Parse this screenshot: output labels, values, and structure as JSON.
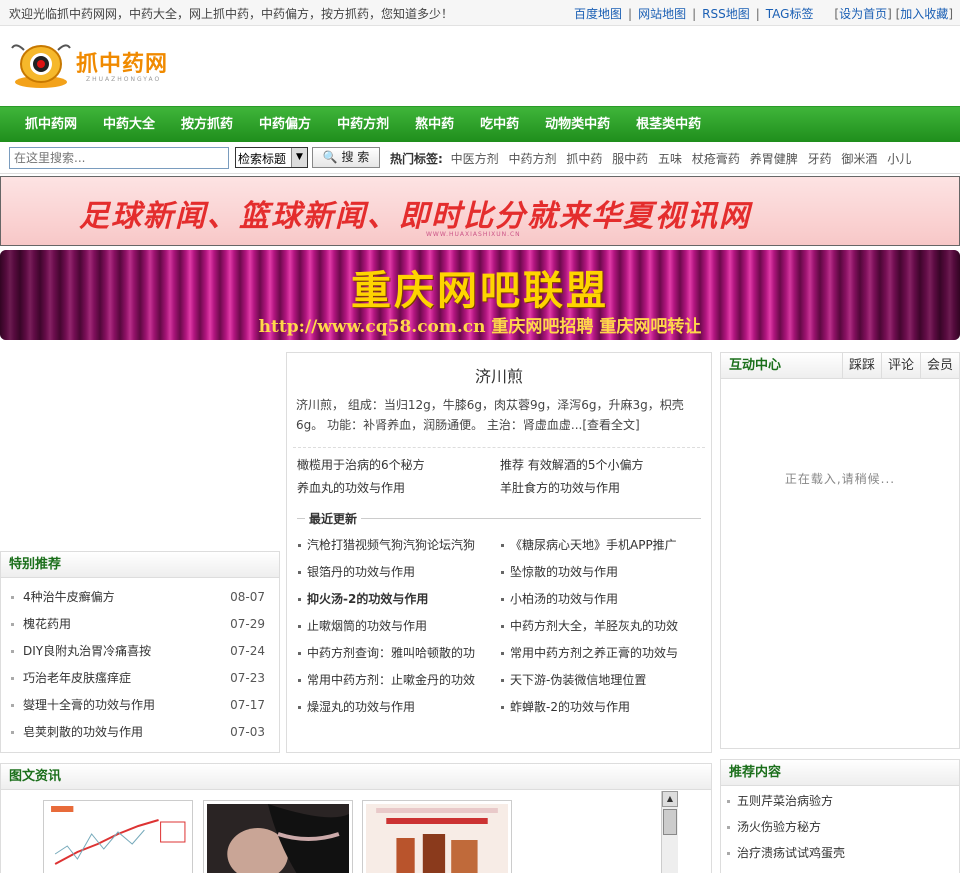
{
  "topbar": {
    "welcome": "欢迎光临抓中药网网，中药大全，网上抓中药，中药偏方，按方抓药，您知道多少！",
    "links": [
      "百度地图",
      "网站地图",
      "RSS地图",
      "TAG标签"
    ],
    "set_home": "设为首页",
    "add_fav": "加入收藏"
  },
  "logo": {
    "text": "抓中药网",
    "sub": "ZHUAZHONGYAO"
  },
  "nav": [
    "抓中药网",
    "中药大全",
    "按方抓药",
    "中药偏方",
    "中药方剂",
    "熬中药",
    "吃中药",
    "动物类中药",
    "根茎类中药"
  ],
  "search": {
    "placeholder": "在这里搜索...",
    "select_value": "检索标题",
    "button": "搜 索",
    "hot_label": "热门标签:",
    "hot_tags": [
      "中医方剂",
      "中药方剂",
      "抓中药",
      "服中药",
      "五味",
      "杖疮膏药",
      "养胃健脾",
      "牙药",
      "御米酒",
      "小儿"
    ]
  },
  "banner1": {
    "text": "足球新闻、篮球新闻、即时比分就来华夏视讯网",
    "sub": "WWW.HUAXIASHIXUN.CN"
  },
  "banner2": {
    "title": "重庆网吧联盟",
    "sub": "http://www.cq58.com.cn 重庆网吧招聘 重庆网吧转让"
  },
  "special": {
    "title": "特别推荐",
    "items": [
      {
        "title": "4种治牛皮癣偏方",
        "date": "08-07"
      },
      {
        "title": "槐花药用",
        "date": "07-29"
      },
      {
        "title": "DIY良附丸治胃冷痛喜按",
        "date": "07-24"
      },
      {
        "title": "巧治老年皮肤瘙痒症",
        "date": "07-23"
      },
      {
        "title": "燮理十全膏的功效与作用",
        "date": "07-17"
      },
      {
        "title": "皂荚刺散的功效与作用",
        "date": "07-03"
      }
    ]
  },
  "headline": {
    "title": "济川煎",
    "summary": "济川煎， 组成：当归12g，牛膝6g，肉苁蓉9g，泽泻6g，升麻3g，枳壳6g。 功能：补肾养血，润肠通便。 主治：肾虚血虚...[查看全文]",
    "featured": [
      "橄榄用于治病的6个秘方",
      "推荐 有效解酒的5个小偏方",
      "养血丸的功效与作用",
      "羊肚食方的功效与作用"
    ],
    "latest_label": "最近更新",
    "latest": [
      "汽枪打猎视频气狗汽狗论坛汽狗",
      "《糖尿病心天地》手机APP推广",
      "银箔丹的功效与作用",
      "坠惊散的功效与作用",
      "抑火汤-2的功效与作用",
      "小柏汤的功效与作用",
      "止嗽烟筒的功效与作用",
      "中药方剂大全，羊胫灰丸的功效",
      "中药方剂查询：雅叫哈顿散的功",
      "常用中药方剂之养正膏的功效与",
      "常用中药方剂：止嗽金丹的功效",
      "天下游-伪装微信地理位置",
      "燥湿丸的功效与作用",
      "蚱蝉散-2的功效与作用"
    ]
  },
  "interact": {
    "title": "互动中心",
    "tabs": [
      "踩踩",
      "评论",
      "会员"
    ],
    "loading": "正在载入,请稍候..."
  },
  "picnews": {
    "title": "图文资讯"
  },
  "recommend": {
    "title": "推荐内容",
    "items": [
      "五则芹菜治病验方",
      "汤火伤验方秘方",
      "治疗溃疡试试鸡蛋壳"
    ]
  }
}
